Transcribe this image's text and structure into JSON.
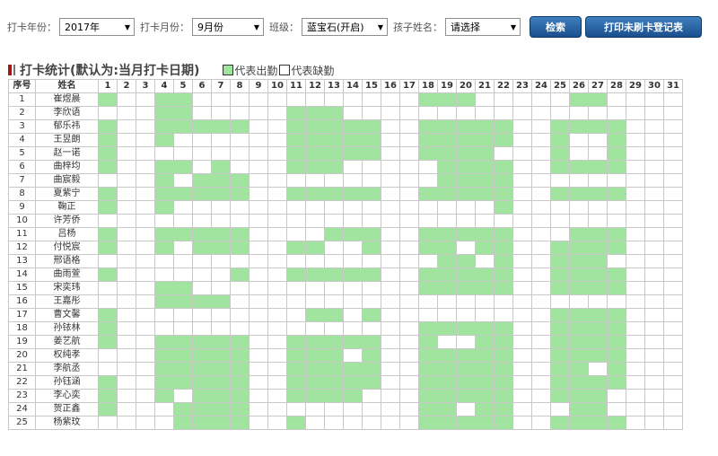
{
  "filters": {
    "year_label": "打卡年份：",
    "year_value": "2017年",
    "month_label": "打卡月份：",
    "month_value": "9月份",
    "class_label": "班级：",
    "class_value": "蓝宝石(开启)",
    "child_label": "孩子姓名：",
    "child_value": "请选择",
    "search_button": "检索",
    "print_button": "打印未刷卡登记表"
  },
  "section": {
    "title": "打卡统计(默认为:当月打卡日期)",
    "legend_present": "代表出勤",
    "legend_absent": "代表缺勤"
  },
  "colors": {
    "present": "#a0e4a0",
    "absent": "#ffffff",
    "button": "#1a4f8c",
    "title_mark": "#a01818"
  },
  "table": {
    "col_no": "序号",
    "col_name": "姓名",
    "days": [
      "1",
      "2",
      "3",
      "4",
      "5",
      "6",
      "7",
      "8",
      "9",
      "10",
      "11",
      "12",
      "13",
      "14",
      "15",
      "16",
      "17",
      "18",
      "19",
      "20",
      "21",
      "22",
      "23",
      "24",
      "25",
      "26",
      "27",
      "28",
      "29",
      "30",
      "31"
    ],
    "rows": [
      {
        "no": "1",
        "name": "崔煜晨",
        "att": [
          1,
          0,
          0,
          1,
          1,
          0,
          0,
          0,
          0,
          0,
          0,
          0,
          0,
          0,
          0,
          0,
          0,
          1,
          1,
          1,
          0,
          0,
          0,
          0,
          0,
          1,
          1,
          0,
          0,
          0,
          0
        ]
      },
      {
        "no": "2",
        "name": "李欣语",
        "att": [
          0,
          0,
          0,
          1,
          1,
          0,
          0,
          0,
          0,
          0,
          1,
          1,
          1,
          0,
          0,
          0,
          0,
          0,
          0,
          0,
          0,
          0,
          0,
          0,
          0,
          0,
          0,
          0,
          0,
          0,
          0
        ]
      },
      {
        "no": "3",
        "name": "郁乐祎",
        "att": [
          1,
          0,
          0,
          1,
          1,
          1,
          1,
          1,
          0,
          0,
          1,
          1,
          1,
          1,
          1,
          0,
          0,
          1,
          1,
          1,
          1,
          1,
          0,
          0,
          1,
          1,
          1,
          1,
          0,
          0,
          0
        ]
      },
      {
        "no": "4",
        "name": "王昱朗",
        "att": [
          1,
          0,
          0,
          1,
          0,
          0,
          0,
          0,
          0,
          0,
          1,
          1,
          1,
          1,
          1,
          0,
          0,
          1,
          1,
          1,
          1,
          1,
          0,
          0,
          1,
          0,
          0,
          1,
          0,
          0,
          0
        ]
      },
      {
        "no": "5",
        "name": "赵一诺",
        "att": [
          1,
          0,
          0,
          0,
          0,
          0,
          0,
          0,
          0,
          0,
          1,
          1,
          1,
          1,
          1,
          0,
          0,
          1,
          1,
          1,
          1,
          0,
          0,
          0,
          1,
          0,
          0,
          1,
          0,
          0,
          0
        ]
      },
      {
        "no": "6",
        "name": "曲梓均",
        "att": [
          1,
          0,
          0,
          1,
          1,
          0,
          1,
          0,
          0,
          0,
          1,
          1,
          1,
          0,
          0,
          0,
          0,
          0,
          1,
          1,
          1,
          1,
          0,
          0,
          1,
          1,
          1,
          1,
          0,
          0,
          0
        ]
      },
      {
        "no": "7",
        "name": "曲宸毅",
        "att": [
          0,
          0,
          0,
          1,
          0,
          1,
          1,
          1,
          0,
          0,
          0,
          0,
          0,
          0,
          0,
          0,
          0,
          0,
          1,
          1,
          1,
          1,
          0,
          0,
          0,
          0,
          0,
          0,
          0,
          0,
          0
        ]
      },
      {
        "no": "8",
        "name": "夏紫宁",
        "att": [
          1,
          0,
          0,
          1,
          1,
          1,
          1,
          1,
          0,
          0,
          1,
          1,
          1,
          1,
          1,
          0,
          0,
          1,
          1,
          1,
          1,
          1,
          0,
          0,
          1,
          1,
          1,
          1,
          0,
          0,
          0
        ]
      },
      {
        "no": "9",
        "name": "鞠正",
        "att": [
          1,
          0,
          0,
          1,
          0,
          0,
          0,
          0,
          0,
          0,
          0,
          0,
          0,
          0,
          0,
          0,
          0,
          0,
          0,
          0,
          0,
          1,
          0,
          0,
          0,
          0,
          0,
          0,
          0,
          0,
          0
        ]
      },
      {
        "no": "10",
        "name": "许芳侨",
        "att": [
          0,
          0,
          0,
          0,
          0,
          0,
          0,
          0,
          0,
          0,
          0,
          0,
          0,
          0,
          0,
          0,
          0,
          0,
          0,
          0,
          0,
          0,
          0,
          0,
          0,
          0,
          0,
          0,
          0,
          0,
          0
        ]
      },
      {
        "no": "11",
        "name": "吕杨",
        "att": [
          1,
          0,
          0,
          1,
          1,
          1,
          1,
          1,
          0,
          0,
          0,
          0,
          1,
          1,
          1,
          0,
          0,
          1,
          1,
          1,
          1,
          1,
          0,
          0,
          0,
          1,
          1,
          1,
          0,
          0,
          0
        ]
      },
      {
        "no": "12",
        "name": "付悦宸",
        "att": [
          1,
          0,
          0,
          1,
          0,
          1,
          1,
          1,
          0,
          0,
          1,
          1,
          0,
          0,
          1,
          0,
          0,
          1,
          1,
          0,
          1,
          1,
          0,
          0,
          1,
          1,
          1,
          1,
          0,
          0,
          0
        ]
      },
      {
        "no": "13",
        "name": "邢语格",
        "att": [
          0,
          0,
          0,
          0,
          0,
          0,
          0,
          0,
          0,
          0,
          0,
          0,
          0,
          0,
          0,
          0,
          0,
          0,
          1,
          1,
          0,
          1,
          0,
          0,
          1,
          1,
          1,
          0,
          0,
          0,
          0
        ]
      },
      {
        "no": "14",
        "name": "曲雨萱",
        "att": [
          1,
          0,
          0,
          0,
          0,
          0,
          0,
          1,
          0,
          0,
          1,
          1,
          1,
          1,
          1,
          0,
          0,
          1,
          1,
          1,
          1,
          1,
          0,
          0,
          1,
          1,
          1,
          1,
          0,
          0,
          0
        ]
      },
      {
        "no": "15",
        "name": "宋奕玮",
        "att": [
          0,
          0,
          0,
          1,
          1,
          0,
          0,
          0,
          0,
          0,
          0,
          0,
          0,
          0,
          0,
          0,
          0,
          1,
          1,
          1,
          1,
          1,
          0,
          0,
          1,
          1,
          1,
          1,
          0,
          0,
          0
        ]
      },
      {
        "no": "16",
        "name": "王嘉彤",
        "att": [
          0,
          0,
          0,
          1,
          1,
          1,
          1,
          0,
          0,
          0,
          0,
          0,
          0,
          0,
          0,
          0,
          0,
          0,
          0,
          0,
          0,
          0,
          0,
          0,
          0,
          0,
          0,
          0,
          0,
          0,
          0
        ]
      },
      {
        "no": "17",
        "name": "曹文馨",
        "att": [
          1,
          0,
          0,
          0,
          0,
          0,
          0,
          0,
          0,
          0,
          0,
          1,
          1,
          0,
          1,
          0,
          0,
          0,
          0,
          0,
          0,
          0,
          0,
          0,
          1,
          1,
          1,
          1,
          0,
          0,
          0
        ]
      },
      {
        "no": "18",
        "name": "孙铱林",
        "att": [
          1,
          0,
          0,
          0,
          0,
          0,
          0,
          0,
          0,
          0,
          0,
          0,
          0,
          0,
          0,
          0,
          0,
          1,
          1,
          1,
          1,
          1,
          0,
          0,
          1,
          1,
          1,
          1,
          0,
          0,
          0
        ]
      },
      {
        "no": "19",
        "name": "姜艺航",
        "att": [
          1,
          0,
          0,
          1,
          1,
          1,
          1,
          1,
          0,
          0,
          1,
          1,
          1,
          1,
          1,
          0,
          0,
          1,
          0,
          0,
          1,
          1,
          0,
          0,
          1,
          1,
          1,
          1,
          0,
          0,
          0
        ]
      },
      {
        "no": "20",
        "name": "权纯孝",
        "att": [
          0,
          0,
          0,
          1,
          1,
          1,
          1,
          1,
          0,
          0,
          1,
          1,
          1,
          0,
          1,
          0,
          0,
          1,
          1,
          1,
          1,
          1,
          0,
          0,
          1,
          1,
          1,
          1,
          0,
          0,
          0
        ]
      },
      {
        "no": "21",
        "name": "李航丞",
        "att": [
          0,
          0,
          0,
          1,
          1,
          1,
          1,
          1,
          0,
          0,
          1,
          1,
          1,
          1,
          1,
          0,
          0,
          1,
          1,
          1,
          1,
          1,
          0,
          0,
          1,
          1,
          0,
          1,
          0,
          0,
          0
        ]
      },
      {
        "no": "22",
        "name": "孙钰涵",
        "att": [
          1,
          0,
          0,
          1,
          1,
          1,
          1,
          1,
          0,
          0,
          1,
          1,
          1,
          1,
          1,
          0,
          0,
          1,
          1,
          1,
          1,
          1,
          0,
          0,
          1,
          1,
          1,
          1,
          0,
          0,
          0
        ]
      },
      {
        "no": "23",
        "name": "李心奕",
        "att": [
          1,
          0,
          0,
          1,
          0,
          1,
          1,
          1,
          0,
          0,
          1,
          1,
          1,
          1,
          0,
          0,
          0,
          1,
          1,
          1,
          1,
          1,
          0,
          0,
          1,
          1,
          1,
          0,
          0,
          0,
          0
        ]
      },
      {
        "no": "24",
        "name": "贺正鑫",
        "att": [
          1,
          0,
          0,
          0,
          1,
          1,
          1,
          1,
          0,
          0,
          0,
          0,
          0,
          0,
          0,
          0,
          0,
          1,
          1,
          0,
          1,
          1,
          0,
          0,
          0,
          1,
          1,
          0,
          0,
          0,
          0
        ]
      },
      {
        "no": "25",
        "name": "杨紫玟",
        "att": [
          0,
          0,
          0,
          0,
          1,
          1,
          1,
          1,
          0,
          0,
          1,
          0,
          0,
          0,
          0,
          0,
          0,
          1,
          1,
          1,
          1,
          1,
          0,
          0,
          1,
          1,
          1,
          1,
          0,
          0,
          0
        ]
      }
    ]
  }
}
